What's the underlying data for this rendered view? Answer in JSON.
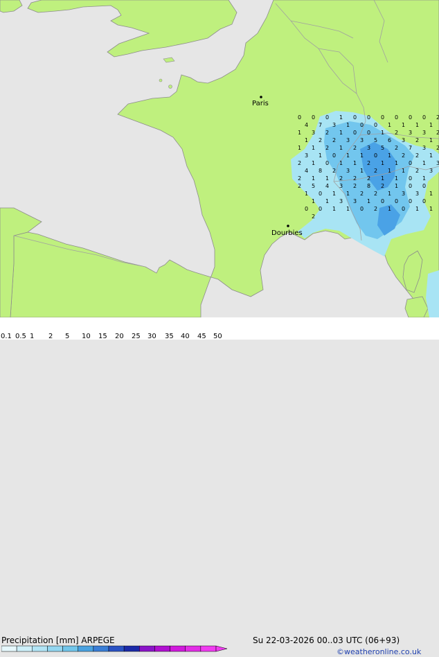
{
  "map": {
    "colors": {
      "sea": "#e6e6e6",
      "land": "#bff07e",
      "border": "#a0a0a0",
      "coast": "#8c8c8c",
      "precip_light": "#a8e4f4",
      "precip_mid": "#72c6ee",
      "precip_heavy": "#4aa2e6",
      "value_text": "#000000"
    },
    "cities": [
      {
        "name": "Paris"
      },
      {
        "name": "Dourbies"
      }
    ],
    "grid_values": [
      "0",
      "0",
      "0",
      "1",
      "0",
      "0",
      "0",
      "0",
      "0",
      "0",
      "2",
      "4",
      "7",
      "3",
      "1",
      "0",
      "0",
      "1",
      "1",
      "1",
      "1",
      "1",
      "3",
      "2",
      "1",
      "0",
      "0",
      "1",
      "2",
      "3",
      "3",
      "2",
      "1",
      "2",
      "2",
      "3",
      "3",
      "5",
      "6",
      "3",
      "2",
      "1",
      "1",
      "1",
      "2",
      "1",
      "2",
      "3",
      "5",
      "2",
      "7",
      "3",
      "2",
      "3",
      "1",
      "0",
      "1",
      "1",
      "0",
      "1",
      "2",
      "2",
      "1",
      "2",
      "1",
      "0",
      "1",
      "1",
      "2",
      "1",
      "1",
      "0",
      "1",
      "3",
      "4",
      "8",
      "2",
      "3",
      "1",
      "2",
      "1",
      "1",
      "2",
      "3",
      "2",
      "1",
      "1",
      "2",
      "2",
      "2",
      "1",
      "1",
      "0",
      "1",
      "2",
      "5",
      "4",
      "3",
      "2",
      "8",
      "2",
      "1",
      "0",
      "0",
      "1",
      "0",
      "1",
      "1",
      "2",
      "2",
      "1",
      "3",
      "3",
      "1",
      "1",
      "1",
      "3",
      "3",
      "1",
      "0",
      "0",
      "0",
      "0",
      "0",
      "0",
      "1",
      "1",
      "0",
      "2",
      "1",
      "0",
      "1",
      "1",
      "2"
    ]
  },
  "footer": {
    "title": "Precipitation [mm]",
    "model": "ARPEGE",
    "datetime": "Su 22-03-2026 00..03 UTC (06+93)",
    "credit": "©weatheronline.co.uk"
  },
  "colorbar": {
    "ticks": [
      "0.1",
      "0.5",
      "1",
      "2",
      "5",
      "10",
      "15",
      "20",
      "25",
      "30",
      "35",
      "40",
      "45",
      "50"
    ],
    "colors": [
      "#e6f8fc",
      "#cdeff9",
      "#b2e4f5",
      "#93d6f0",
      "#72c6ea",
      "#4aa2e0",
      "#3a7ed6",
      "#2a52c4",
      "#1b2aa8",
      "#8a14c8",
      "#b010d0",
      "#d01adc",
      "#e22ee6",
      "#f03cf0"
    ]
  }
}
